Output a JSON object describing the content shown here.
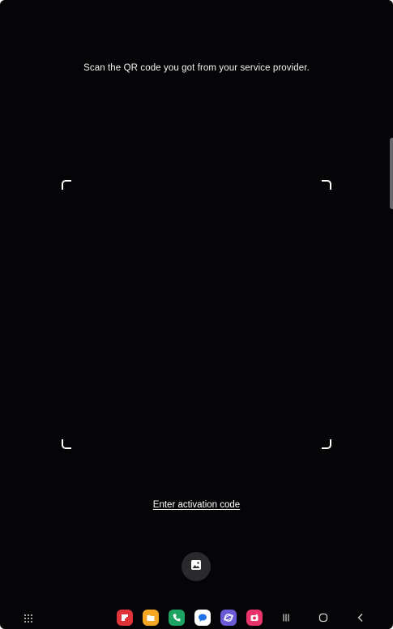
{
  "scanner": {
    "instruction": "Scan the QR code you got from your service provider.",
    "enter_code_label": "Enter activation code",
    "gallery_icon": "image-icon"
  },
  "taskbar": {
    "apps": [
      {
        "name": "flipboard-icon",
        "color": "#e0343a"
      },
      {
        "name": "my-files-icon",
        "color": "#f5a623"
      },
      {
        "name": "phone-icon",
        "color": "#1da462"
      },
      {
        "name": "messages-icon",
        "color": "#ffffff"
      },
      {
        "name": "internet-icon",
        "color": "#6a5ad6"
      },
      {
        "name": "camera-icon",
        "color": "#e8336b"
      }
    ],
    "nav": [
      "recents-icon",
      "home-icon",
      "back-icon"
    ]
  },
  "colors": {
    "background": "#050407",
    "text": "#f2f2f2",
    "button_bg": "#2a2a2d"
  }
}
